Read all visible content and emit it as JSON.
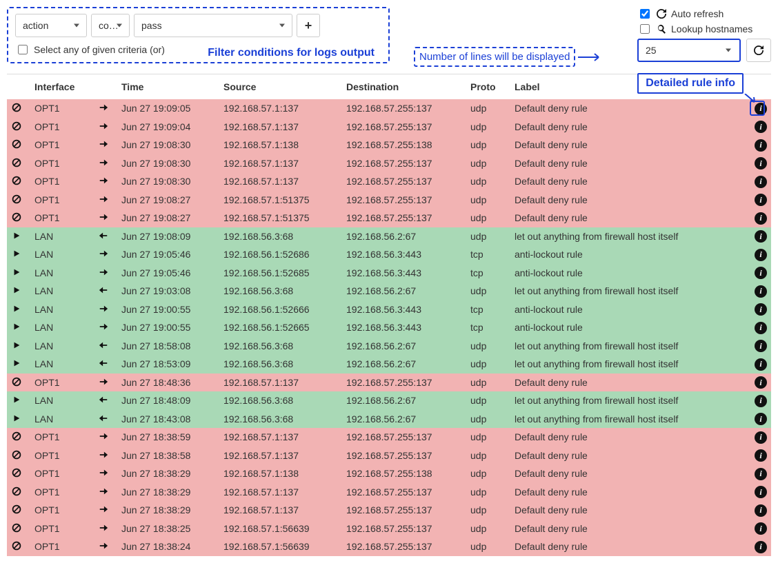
{
  "filters": {
    "field_value": "action",
    "op_value": "co…",
    "value_value": "pass",
    "select_any_label": "Select any of given criteria (or)",
    "annotation": "Filter conditions for logs output"
  },
  "options": {
    "auto_refresh_label": "Auto refresh",
    "auto_refresh_checked": true,
    "lookup_hostnames_label": "Lookup hostnames",
    "lookup_hostnames_checked": false
  },
  "lines": {
    "annotation": "Number of lines will be displayed",
    "value": "25"
  },
  "detail_annotation": "Detailed rule info",
  "headers": {
    "interface": "Interface",
    "time": "Time",
    "source": "Source",
    "destination": "Destination",
    "proto": "Proto",
    "label": "Label"
  },
  "rows": [
    {
      "action": "block",
      "if": "OPT1",
      "dir": "out",
      "time": "Jun 27 19:09:05",
      "src": "192.168.57.1:137",
      "dst": "192.168.57.255:137",
      "proto": "udp",
      "label": "Default deny rule"
    },
    {
      "action": "block",
      "if": "OPT1",
      "dir": "out",
      "time": "Jun 27 19:09:04",
      "src": "192.168.57.1:137",
      "dst": "192.168.57.255:137",
      "proto": "udp",
      "label": "Default deny rule"
    },
    {
      "action": "block",
      "if": "OPT1",
      "dir": "out",
      "time": "Jun 27 19:08:30",
      "src": "192.168.57.1:138",
      "dst": "192.168.57.255:138",
      "proto": "udp",
      "label": "Default deny rule"
    },
    {
      "action": "block",
      "if": "OPT1",
      "dir": "out",
      "time": "Jun 27 19:08:30",
      "src": "192.168.57.1:137",
      "dst": "192.168.57.255:137",
      "proto": "udp",
      "label": "Default deny rule"
    },
    {
      "action": "block",
      "if": "OPT1",
      "dir": "out",
      "time": "Jun 27 19:08:30",
      "src": "192.168.57.1:137",
      "dst": "192.168.57.255:137",
      "proto": "udp",
      "label": "Default deny rule"
    },
    {
      "action": "block",
      "if": "OPT1",
      "dir": "out",
      "time": "Jun 27 19:08:27",
      "src": "192.168.57.1:51375",
      "dst": "192.168.57.255:137",
      "proto": "udp",
      "label": "Default deny rule"
    },
    {
      "action": "block",
      "if": "OPT1",
      "dir": "out",
      "time": "Jun 27 19:08:27",
      "src": "192.168.57.1:51375",
      "dst": "192.168.57.255:137",
      "proto": "udp",
      "label": "Default deny rule"
    },
    {
      "action": "pass",
      "if": "LAN",
      "dir": "in",
      "time": "Jun 27 19:08:09",
      "src": "192.168.56.3:68",
      "dst": "192.168.56.2:67",
      "proto": "udp",
      "label": "let out anything from firewall host itself"
    },
    {
      "action": "pass",
      "if": "LAN",
      "dir": "out",
      "time": "Jun 27 19:05:46",
      "src": "192.168.56.1:52686",
      "dst": "192.168.56.3:443",
      "proto": "tcp",
      "label": "anti-lockout rule"
    },
    {
      "action": "pass",
      "if": "LAN",
      "dir": "out",
      "time": "Jun 27 19:05:46",
      "src": "192.168.56.1:52685",
      "dst": "192.168.56.3:443",
      "proto": "tcp",
      "label": "anti-lockout rule"
    },
    {
      "action": "pass",
      "if": "LAN",
      "dir": "in",
      "time": "Jun 27 19:03:08",
      "src": "192.168.56.3:68",
      "dst": "192.168.56.2:67",
      "proto": "udp",
      "label": "let out anything from firewall host itself"
    },
    {
      "action": "pass",
      "if": "LAN",
      "dir": "out",
      "time": "Jun 27 19:00:55",
      "src": "192.168.56.1:52666",
      "dst": "192.168.56.3:443",
      "proto": "tcp",
      "label": "anti-lockout rule"
    },
    {
      "action": "pass",
      "if": "LAN",
      "dir": "out",
      "time": "Jun 27 19:00:55",
      "src": "192.168.56.1:52665",
      "dst": "192.168.56.3:443",
      "proto": "tcp",
      "label": "anti-lockout rule"
    },
    {
      "action": "pass",
      "if": "LAN",
      "dir": "in",
      "time": "Jun 27 18:58:08",
      "src": "192.168.56.3:68",
      "dst": "192.168.56.2:67",
      "proto": "udp",
      "label": "let out anything from firewall host itself"
    },
    {
      "action": "pass",
      "if": "LAN",
      "dir": "in",
      "time": "Jun 27 18:53:09",
      "src": "192.168.56.3:68",
      "dst": "192.168.56.2:67",
      "proto": "udp",
      "label": "let out anything from firewall host itself"
    },
    {
      "action": "block",
      "if": "OPT1",
      "dir": "out",
      "time": "Jun 27 18:48:36",
      "src": "192.168.57.1:137",
      "dst": "192.168.57.255:137",
      "proto": "udp",
      "label": "Default deny rule"
    },
    {
      "action": "pass",
      "if": "LAN",
      "dir": "in",
      "time": "Jun 27 18:48:09",
      "src": "192.168.56.3:68",
      "dst": "192.168.56.2:67",
      "proto": "udp",
      "label": "let out anything from firewall host itself"
    },
    {
      "action": "pass",
      "if": "LAN",
      "dir": "in",
      "time": "Jun 27 18:43:08",
      "src": "192.168.56.3:68",
      "dst": "192.168.56.2:67",
      "proto": "udp",
      "label": "let out anything from firewall host itself"
    },
    {
      "action": "block",
      "if": "OPT1",
      "dir": "out",
      "time": "Jun 27 18:38:59",
      "src": "192.168.57.1:137",
      "dst": "192.168.57.255:137",
      "proto": "udp",
      "label": "Default deny rule"
    },
    {
      "action": "block",
      "if": "OPT1",
      "dir": "out",
      "time": "Jun 27 18:38:58",
      "src": "192.168.57.1:137",
      "dst": "192.168.57.255:137",
      "proto": "udp",
      "label": "Default deny rule"
    },
    {
      "action": "block",
      "if": "OPT1",
      "dir": "out",
      "time": "Jun 27 18:38:29",
      "src": "192.168.57.1:138",
      "dst": "192.168.57.255:138",
      "proto": "udp",
      "label": "Default deny rule"
    },
    {
      "action": "block",
      "if": "OPT1",
      "dir": "out",
      "time": "Jun 27 18:38:29",
      "src": "192.168.57.1:137",
      "dst": "192.168.57.255:137",
      "proto": "udp",
      "label": "Default deny rule"
    },
    {
      "action": "block",
      "if": "OPT1",
      "dir": "out",
      "time": "Jun 27 18:38:29",
      "src": "192.168.57.1:137",
      "dst": "192.168.57.255:137",
      "proto": "udp",
      "label": "Default deny rule"
    },
    {
      "action": "block",
      "if": "OPT1",
      "dir": "out",
      "time": "Jun 27 18:38:25",
      "src": "192.168.57.1:56639",
      "dst": "192.168.57.255:137",
      "proto": "udp",
      "label": "Default deny rule"
    },
    {
      "action": "block",
      "if": "OPT1",
      "dir": "out",
      "time": "Jun 27 18:38:24",
      "src": "192.168.57.1:56639",
      "dst": "192.168.57.255:137",
      "proto": "udp",
      "label": "Default deny rule"
    }
  ]
}
